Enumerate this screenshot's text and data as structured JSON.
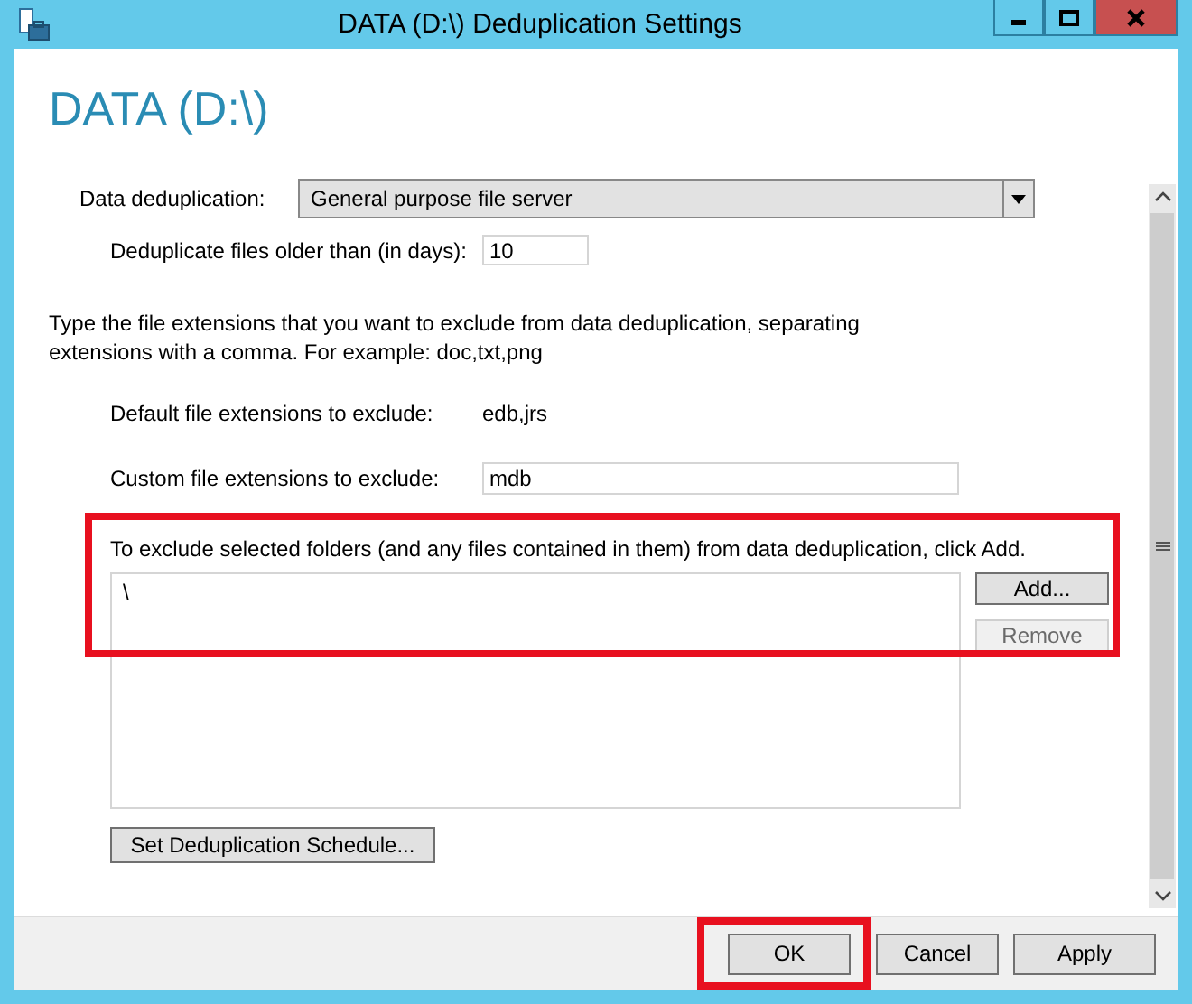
{
  "window": {
    "title": "DATA (D:\\) Deduplication Settings"
  },
  "heading": "DATA (D:\\)",
  "dedup_mode": {
    "label": "Data deduplication:",
    "value": "General purpose file server"
  },
  "age": {
    "label": "Deduplicate files older than (in days):",
    "value": "10"
  },
  "instructions": "Type the file extensions that you want to exclude from data deduplication, separating extensions with a comma. For example: doc,txt,png",
  "default_extensions": {
    "label": "Default file extensions to exclude:",
    "value": "edb,jrs"
  },
  "custom_extensions": {
    "label": "Custom file extensions to exclude:",
    "value": "mdb"
  },
  "excluded_folders": {
    "label": "To exclude selected folders (and any files contained in them) from data deduplication, click Add.",
    "highlighted": true,
    "items": [
      "\\"
    ],
    "buttons": [
      {
        "label": "Add...",
        "disabled": false
      },
      {
        "label": "Remove",
        "disabled": true
      }
    ]
  },
  "schedule_button": "Set Deduplication Schedule...",
  "footer_buttons": [
    {
      "label": "OK",
      "highlighted": true
    },
    {
      "label": "Cancel",
      "highlighted": false
    },
    {
      "label": "Apply",
      "highlighted": false
    }
  ]
}
